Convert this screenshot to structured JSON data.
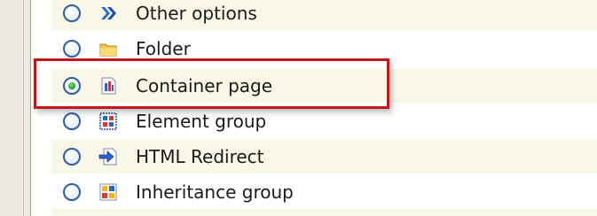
{
  "options": [
    {
      "label": "Other options",
      "icon": "double-chevron-right-icon",
      "selected": false
    },
    {
      "label": "Folder",
      "icon": "folder-icon",
      "selected": false
    },
    {
      "label": "Container page",
      "icon": "container-page-icon",
      "selected": true
    },
    {
      "label": "Element group",
      "icon": "element-group-icon",
      "selected": false
    },
    {
      "label": "HTML Redirect",
      "icon": "html-redirect-icon",
      "selected": false
    },
    {
      "label": "Inheritance group",
      "icon": "inheritance-group-icon",
      "selected": false
    }
  ],
  "colors": {
    "highlight_border": "#c0181e",
    "radio_border": "#2b5fa8",
    "radio_selected": "#2aa42a",
    "row_alt_bg": "#f9f8e8"
  }
}
